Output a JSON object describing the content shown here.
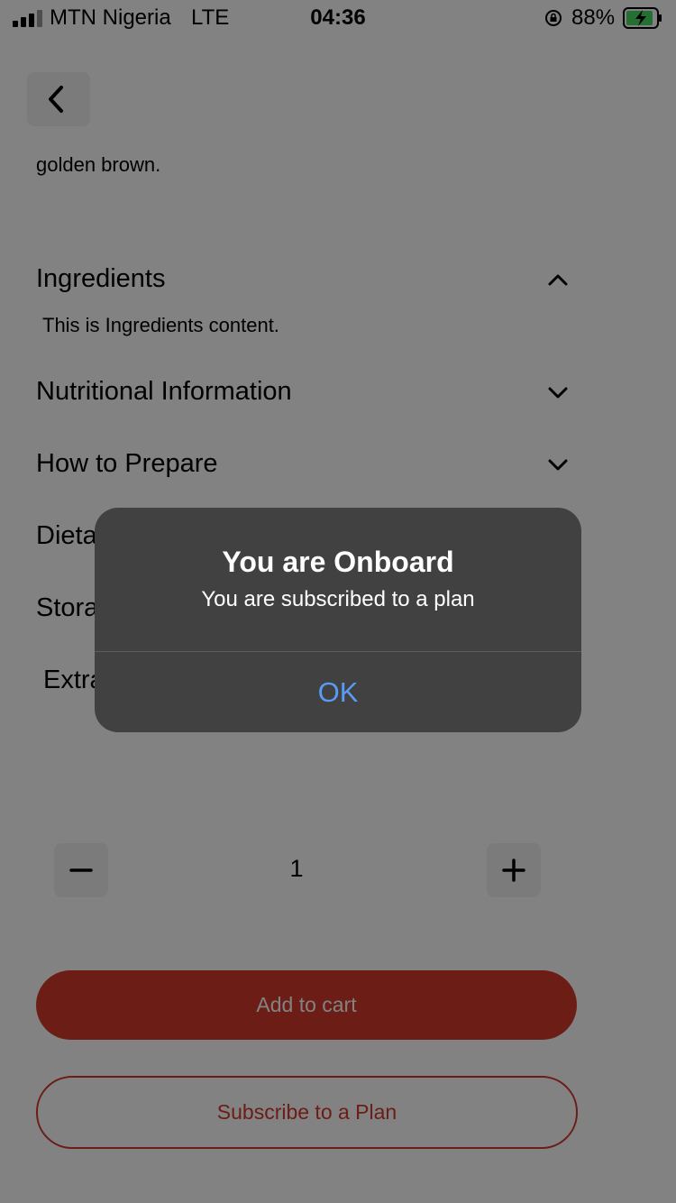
{
  "status_bar": {
    "carrier": "MTN Nigeria",
    "network": "LTE",
    "time": "04:36",
    "battery": "88%",
    "battery_level": 0.88
  },
  "product": {
    "description_tail": "golden brown."
  },
  "sections": {
    "ingredients": {
      "title": "Ingredients",
      "content": "This is Ingredients content.",
      "expanded": true
    },
    "nutritional": {
      "title": "Nutritional Information",
      "expanded": false
    },
    "prepare": {
      "title": "How to Prepare",
      "expanded": false
    },
    "dietary": {
      "title": "Dieta"
    },
    "storage": {
      "title": "Stora"
    },
    "extra": {
      "title": "Extra"
    }
  },
  "quantity": {
    "value": "1"
  },
  "actions": {
    "add_to_cart": "Add to cart",
    "subscribe": "Subscribe to a Plan"
  },
  "alert": {
    "title": "You are Onboard",
    "message": "You are subscribed to a plan",
    "ok": "OK"
  },
  "colors": {
    "accent": "#d5392b",
    "alert_background": "#414141",
    "alert_button": "#5a9bf5"
  },
  "icons": [
    "signal-icon",
    "rotation-lock-icon",
    "battery-charging-icon",
    "back-chevron-icon",
    "chevron-up-icon",
    "chevron-down-icon",
    "minus-icon",
    "plus-icon"
  ]
}
